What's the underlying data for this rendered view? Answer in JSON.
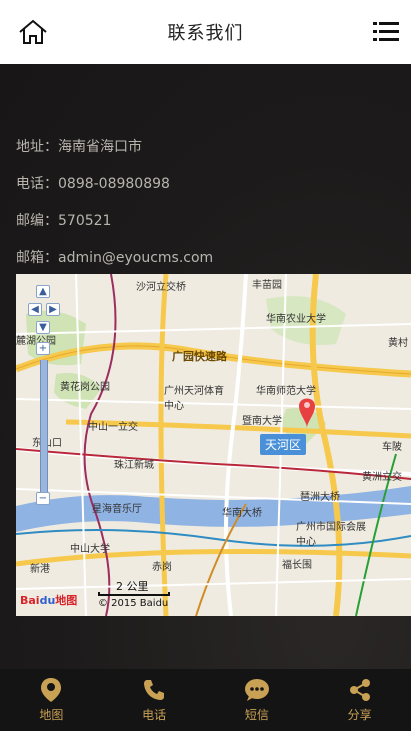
{
  "header": {
    "title": "联系我们",
    "home_icon": "home-icon",
    "menu_icon": "list-menu-icon"
  },
  "contact": {
    "address": "地址：海南省海口市",
    "phone": "电话：0898-08980898",
    "postcode": "邮编：570521",
    "email": "邮箱：admin@eyoucms.com"
  },
  "map": {
    "district": "天河区",
    "scale": "2 公里",
    "copyright": "© 2015 Baidu",
    "logo_text": "Bai",
    "logo_suffix": "地图",
    "labels": [
      "沙河立交桥",
      "丰苗园",
      "华南农业大学",
      "麓湖公园",
      "黄村",
      "黄花岗公园",
      "广园快速路",
      "广州天河体育中心",
      "华南师范大学",
      "中山一立交",
      "暨南大学",
      "东山口",
      "珠江新城",
      "车陂",
      "黄洲立交",
      "星海音乐厅",
      "琶洲大桥",
      "华南大桥",
      "广州市国际会展中心",
      "中山大学",
      "赤岗",
      "福长围",
      "新港"
    ],
    "colors": {
      "marker": "#e84040",
      "river": "#8fb3e3",
      "major_road": "#f6c84c",
      "district_badge": "#4a90d9"
    }
  },
  "bottom_nav": [
    {
      "label": "地图",
      "icon": "location-pin-icon"
    },
    {
      "label": "电话",
      "icon": "phone-icon"
    },
    {
      "label": "短信",
      "icon": "chat-bubble-icon"
    },
    {
      "label": "分享",
      "icon": "share-icon"
    }
  ],
  "colors": {
    "accent": "#c9a155",
    "background": "#1d1b1b",
    "text_muted": "#b9b4ae"
  }
}
